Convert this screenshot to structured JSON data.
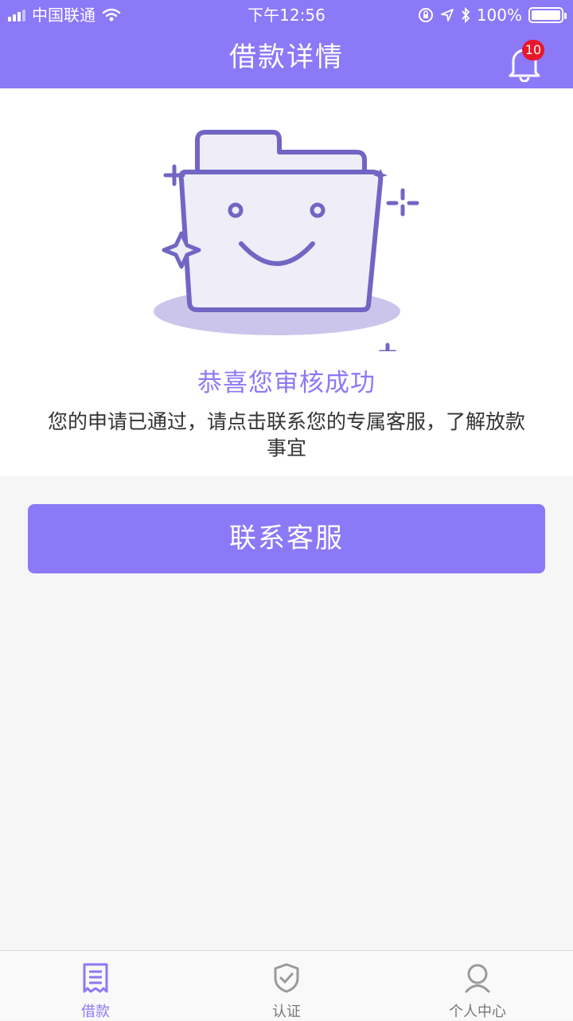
{
  "status_bar": {
    "carrier": "中国联通",
    "time": "下午12:56",
    "battery": "100%"
  },
  "header": {
    "title": "借款详情",
    "notification_count": "10"
  },
  "result": {
    "title": "恭喜您审核成功",
    "description": "您的申请已通过，请点击联系您的专属客服，了解放款事宜"
  },
  "actions": {
    "contact_label": "联系客服"
  },
  "tabbar": {
    "items": [
      {
        "label": "借款",
        "icon": "document-icon",
        "active": true
      },
      {
        "label": "认证",
        "icon": "shield-check-icon",
        "active": false
      },
      {
        "label": "个人中心",
        "icon": "user-icon",
        "active": false
      }
    ]
  },
  "colors": {
    "accent": "#8b79f7",
    "badge": "#e8182b",
    "background": "#f6f6f6"
  }
}
